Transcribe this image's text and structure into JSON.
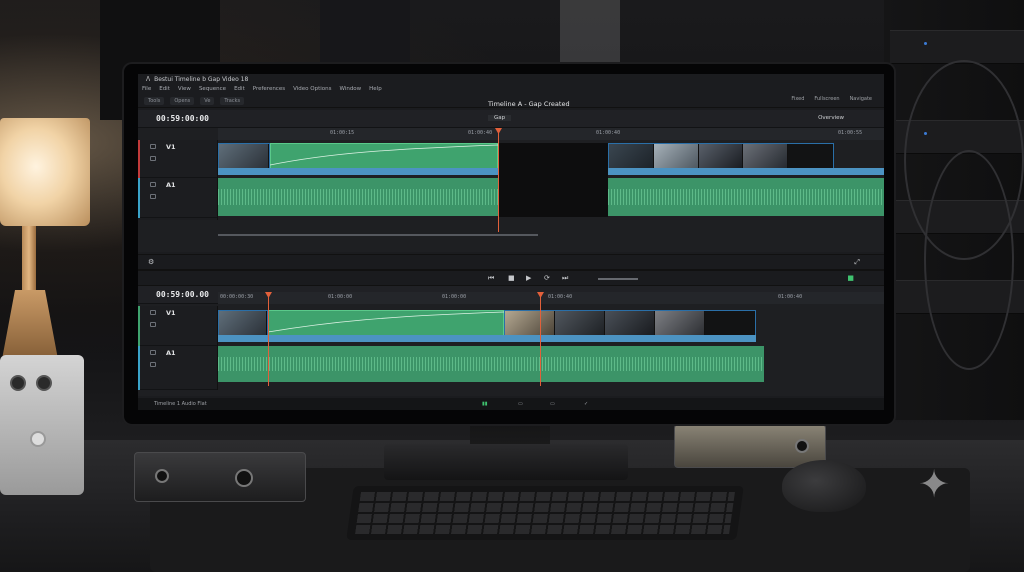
{
  "app": {
    "title": "Bestui Timeline b Gap Video 18",
    "menu": [
      "File",
      "Edit",
      "View",
      "Sequence",
      "Edit",
      "Preferences",
      "Video Options",
      "Window",
      "Help"
    ],
    "toolbar": [
      "Tools",
      "Opens",
      "Ve",
      "Tracks"
    ],
    "toolbar_right": [
      "Fixed",
      "Fullscreen",
      "Navigate"
    ],
    "timeline_title": "Timeline A - Gap Created",
    "dropdown": "Gap",
    "dropdown_right": "Overview"
  },
  "upper_timeline": {
    "timecode": "00:59:00:00",
    "ruler": [
      "01:00:15",
      "01:00:40",
      "01:00:40",
      "01:00:55"
    ],
    "tracks": [
      {
        "name": "V1"
      },
      {
        "name": "A1"
      }
    ]
  },
  "lower_timeline": {
    "timecode": "00:59:00.00",
    "ruler": [
      "00:00:00:30",
      "01:00:00",
      "01:00:00",
      "01:00:40",
      "01:00:40"
    ],
    "tracks": [
      {
        "name": "V1"
      },
      {
        "name": "A1"
      }
    ]
  },
  "footer": {
    "left": "Timeline 1 Audio Flat"
  },
  "colors": {
    "clip_green": "#3fa36e",
    "clip_blue": "#4c93c2",
    "playhead": "#e2603b",
    "video_track_marker": "#c23b3b",
    "audio_track_marker": "#3aa3c9"
  },
  "icons": [
    "lamp",
    "mixer",
    "audio-interface",
    "keyboard",
    "mouse",
    "sparkle-icon"
  ]
}
